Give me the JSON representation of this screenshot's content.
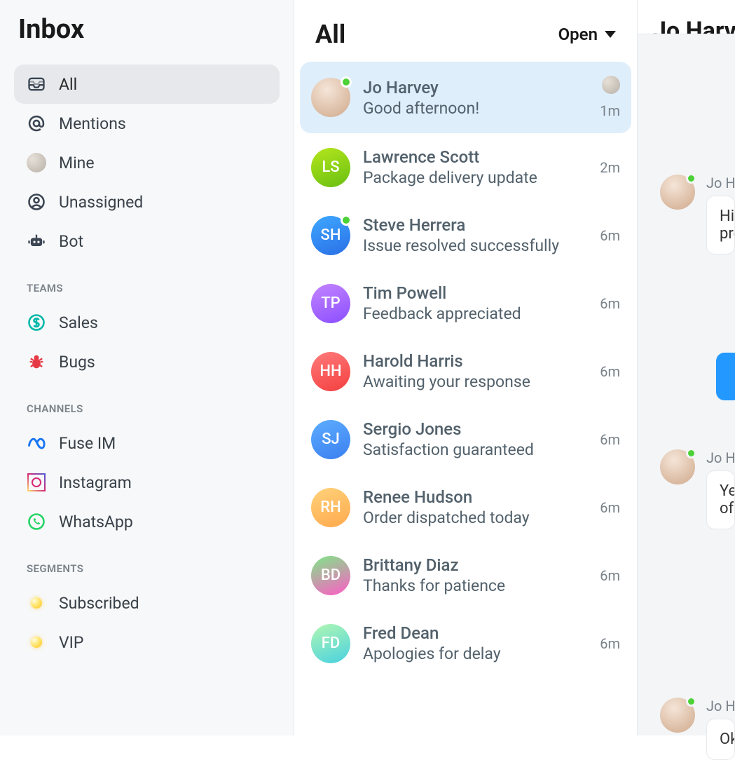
{
  "sidebar": {
    "title": "Inbox",
    "items": [
      {
        "label": "All",
        "icon": "inbox-icon",
        "active": true
      },
      {
        "label": "Mentions",
        "icon": "at-icon"
      },
      {
        "label": "Mine",
        "icon": "avatar-icon"
      },
      {
        "label": "Unassigned",
        "icon": "person-icon"
      },
      {
        "label": "Bot",
        "icon": "bot-icon"
      }
    ],
    "teams_header": "TEAMS",
    "teams": [
      {
        "label": "Sales",
        "icon": "dollar-icon"
      },
      {
        "label": "Bugs",
        "icon": "bug-icon"
      }
    ],
    "channels_header": "CHANNELS",
    "channels": [
      {
        "label": "Fuse IM",
        "icon": "meta-icon"
      },
      {
        "label": "Instagram",
        "icon": "instagram-icon"
      },
      {
        "label": "WhatsApp",
        "icon": "whatsapp-icon"
      }
    ],
    "segments_header": "SEGMENTS",
    "segments": [
      {
        "label": "Subscribed",
        "icon": "dot-icon"
      },
      {
        "label": "VIP",
        "icon": "dot-icon"
      }
    ]
  },
  "list": {
    "title": "All",
    "filter": "Open",
    "conversations": [
      {
        "name": "Jo Harvey",
        "preview": "Good afternoon!",
        "time": "1m",
        "selected": true,
        "avatar_type": "photo",
        "initials": "",
        "assignee": true,
        "online": true,
        "grad": "g-photo"
      },
      {
        "name": "Lawrence Scott",
        "preview": "Package delivery update",
        "time": "2m",
        "initials": "LS",
        "grad": "g-green"
      },
      {
        "name": "Steve Herrera",
        "preview": "Issue resolved successfully",
        "time": "6m",
        "initials": "SH",
        "grad": "g-blue",
        "online": true
      },
      {
        "name": "Tim Powell",
        "preview": "Feedback appreciated",
        "time": "6m",
        "initials": "TP",
        "grad": "g-purple"
      },
      {
        "name": "Harold Harris",
        "preview": "Awaiting your response",
        "time": "6m",
        "initials": "HH",
        "grad": "g-red"
      },
      {
        "name": "Sergio Jones",
        "preview": "Satisfaction guaranteed",
        "time": "6m",
        "initials": "SJ",
        "grad": "g-blue2"
      },
      {
        "name": "Renee Hudson",
        "preview": "Order dispatched today",
        "time": "6m",
        "initials": "RH",
        "grad": "g-orange"
      },
      {
        "name": "Brittany Diaz",
        "preview": "Thanks for patience",
        "time": "6m",
        "initials": "BD",
        "grad": "g-pink"
      },
      {
        "name": "Fred Dean",
        "preview": "Apologies for delay",
        "time": "6m",
        "initials": "FD",
        "grad": "g-teal"
      }
    ]
  },
  "detail": {
    "title": "Jo Harvey",
    "messages": [
      {
        "sender": "Jo Harvey",
        "text_line1": "Hi there, I need help with a",
        "text_line2": "product.",
        "type": "in"
      },
      {
        "type": "out"
      },
      {
        "sender": "Jo Harvey",
        "text_line1": "Yes, I recently bought a set",
        "text_line2": "of headphones.",
        "type": "in"
      },
      {
        "sender": "Jo Harvey",
        "text_line1": "Okay thanks.",
        "type": "in"
      }
    ]
  }
}
